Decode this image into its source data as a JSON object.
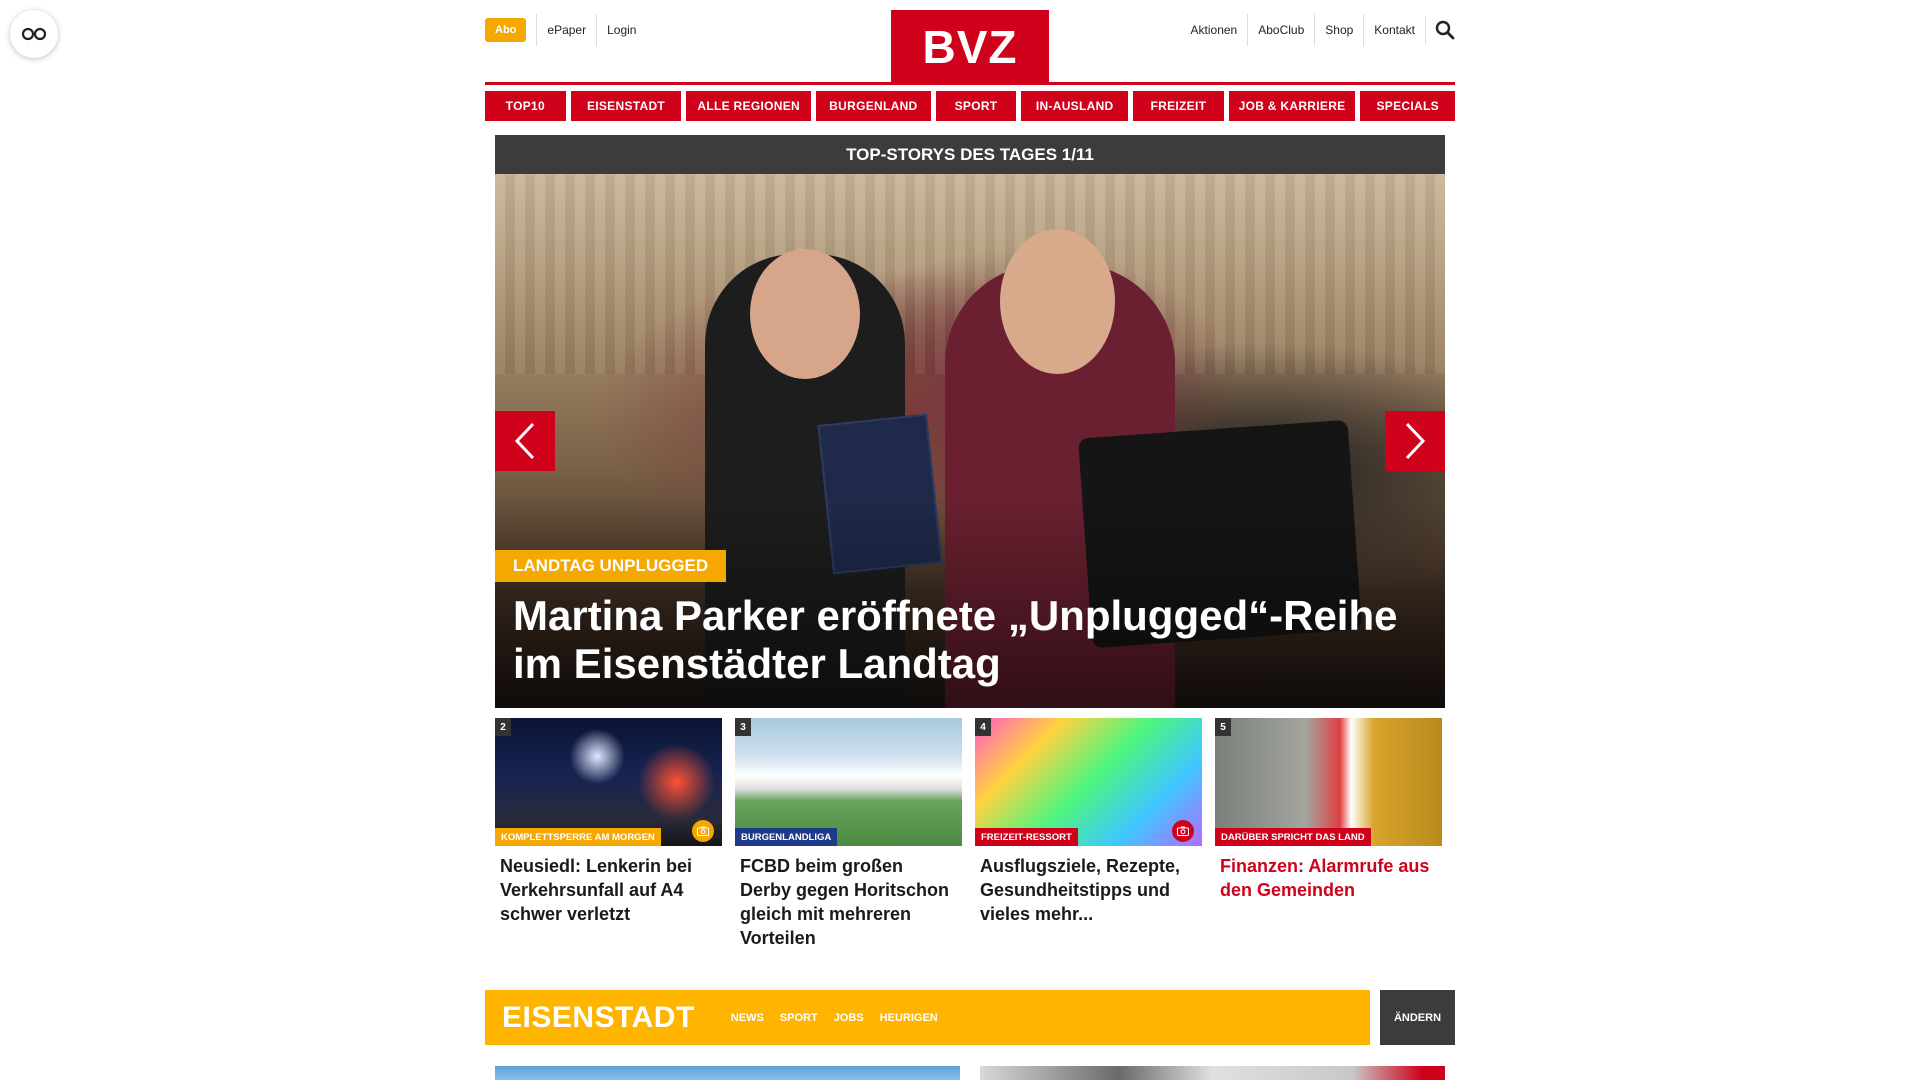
{
  "header": {
    "abo_label": "Abo",
    "left_links": [
      "ePaper",
      "Login"
    ],
    "logo_text": "BVZ",
    "right_links": [
      "Aktionen",
      "AboClub",
      "Shop",
      "Kontakt"
    ]
  },
  "nav": {
    "items": [
      {
        "label": "TOP10",
        "width": 74
      },
      {
        "label": "EISENSTADT",
        "width": 113
      },
      {
        "label": "ALLE REGIONEN",
        "width": 129
      },
      {
        "label": "BURGENLAND",
        "width": 118
      },
      {
        "label": "SPORT",
        "width": 74
      },
      {
        "label": "IN-AUSLAND",
        "width": 108
      },
      {
        "label": "FREIZEIT",
        "width": 86
      },
      {
        "label": "JOB & KARRIERE",
        "width": 130
      },
      {
        "label": "SPECIALS",
        "width": 92
      }
    ]
  },
  "top_stories": {
    "heading": "TOP-STORYS DES TAGES 1/11",
    "hero": {
      "kicker": "LANDTAG UNPLUGGED",
      "title": "Martina Parker eröffnete „Unplugged“-Reihe im Eisenstädter Landtag"
    },
    "teasers": [
      {
        "num": "2",
        "kicker": "KOMPLETTSPERRE AM MORGEN",
        "kicker_color": "#f5a800",
        "title": "Neusiedl: Lenkerin bei Verkehrsunfall auf A4 schwer verletzt",
        "has_camera": true,
        "cam_color": "#f5a800",
        "title_red": false
      },
      {
        "num": "3",
        "kicker": "BURGENLANDLIGA",
        "kicker_color": "#1f3a8a",
        "title": "FCBD beim großen Derby gegen Horitschon gleich mit mehreren Vorteilen",
        "has_camera": false,
        "title_red": false
      },
      {
        "num": "4",
        "kicker": "FREIZEIT-RESSORT",
        "kicker_color": "#d0021b",
        "title": "Ausflugsziele, Rezepte, Gesundheitstipps und vieles mehr...",
        "has_camera": true,
        "cam_color": "#d0021b",
        "title_red": false
      },
      {
        "num": "5",
        "kicker": "DARÜBER SPRICHT DAS LAND",
        "kicker_color": "#d0021b",
        "title": "Finanzen: Alarmrufe aus den Gemeinden",
        "has_camera": false,
        "title_red": true
      }
    ]
  },
  "section": {
    "title": "EISENSTADT",
    "links": [
      "NEWS",
      "SPORT",
      "JOBS",
      "HEURIGEN"
    ],
    "change_label": "ÄNDERN"
  },
  "colors": {
    "brand_red": "#d0021b",
    "accent_yellow": "#f5a800",
    "section_yellow": "#ffb400",
    "dark_bar": "#3c3c3c"
  },
  "icons": {
    "side_toggle": "glasses-icon",
    "search": "search-icon",
    "prev": "chevron-left-icon",
    "next": "chevron-right-icon",
    "camera": "camera-icon"
  }
}
